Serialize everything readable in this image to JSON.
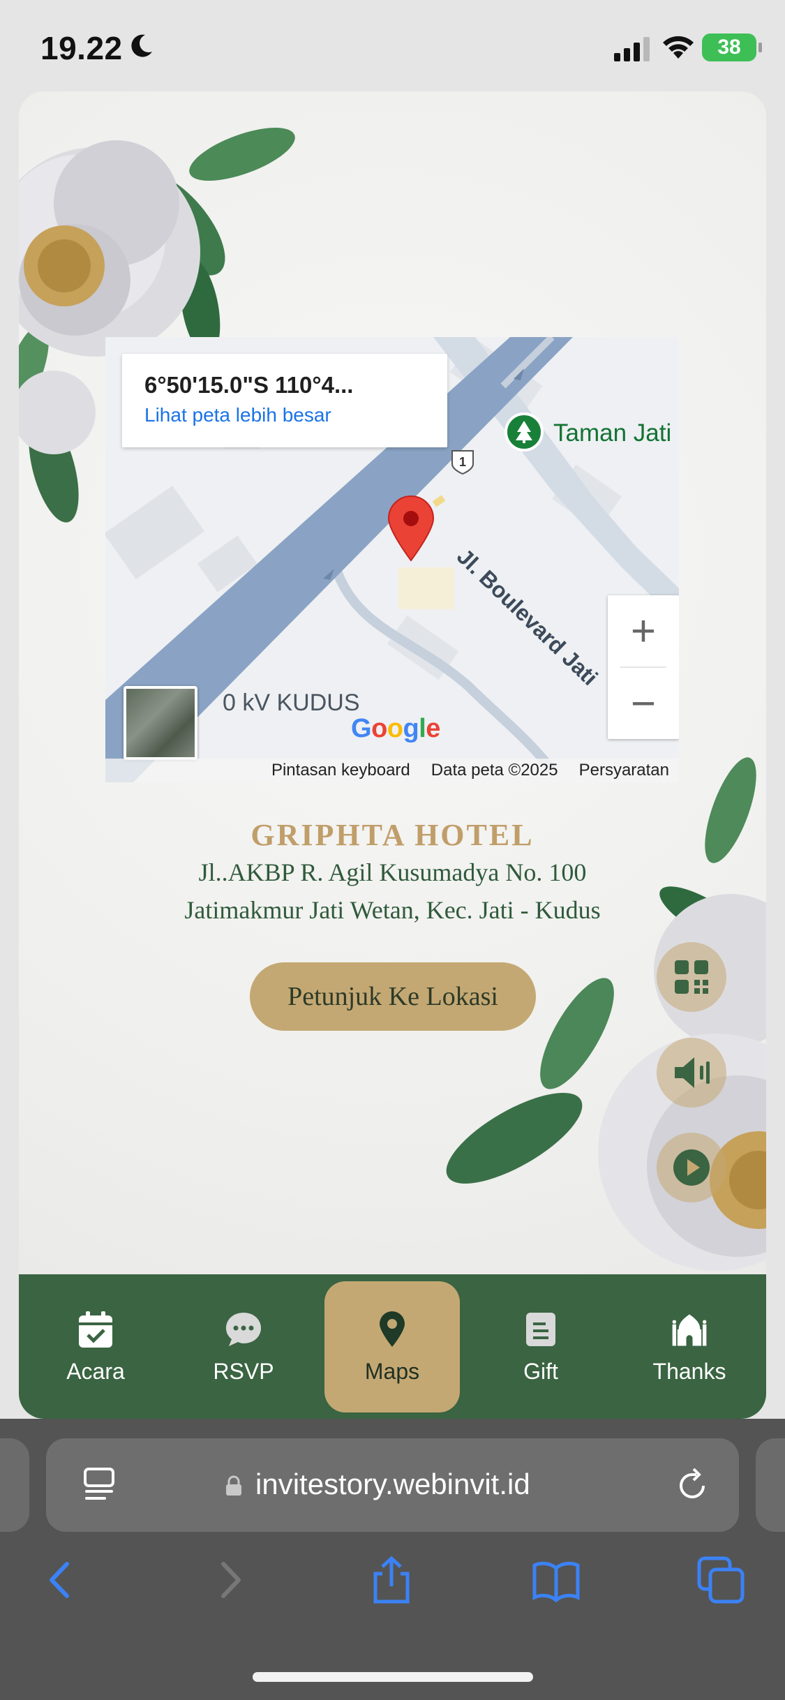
{
  "status_bar": {
    "time": "19.22",
    "battery": "38"
  },
  "map": {
    "coords": "6°50'15.0\"S 110°4...",
    "larger_map_link": "Lihat peta lebih besar",
    "park_label": "Taman Jati In",
    "kv_label": "0 kV KUDUS",
    "road_label": "Jl. Boulevard Jati",
    "route_shield": "1",
    "zoom_in": "+",
    "zoom_out": "−",
    "google_logo": "Google",
    "footer": {
      "shortcuts": "Pintasan keyboard",
      "map_data": "Data peta ©2025",
      "terms": "Persyaratan"
    }
  },
  "venue": {
    "name": "GRIPHTA HOTEL",
    "address_line1": "Jl..AKBP R. Agil Kusumadya No. 100",
    "address_line2": "Jatimakmur Jati Wetan, Kec. Jati - Kudus",
    "directions_button": "Petunjuk Ke Lokasi"
  },
  "bottom_nav": {
    "items": [
      {
        "label": "Acara",
        "icon": "calendar-check-icon"
      },
      {
        "label": "RSVP",
        "icon": "chat-bubble-icon"
      },
      {
        "label": "Maps",
        "icon": "map-pin-icon",
        "active": true
      },
      {
        "label": "Gift",
        "icon": "gift-card-icon"
      },
      {
        "label": "Thanks",
        "icon": "mosque-icon"
      }
    ]
  },
  "browser": {
    "url": "invitestory.webinvit.id"
  },
  "colors": {
    "primary_green": "#3a6442",
    "gold": "#c4a873",
    "link_blue": "#1a73e8"
  }
}
